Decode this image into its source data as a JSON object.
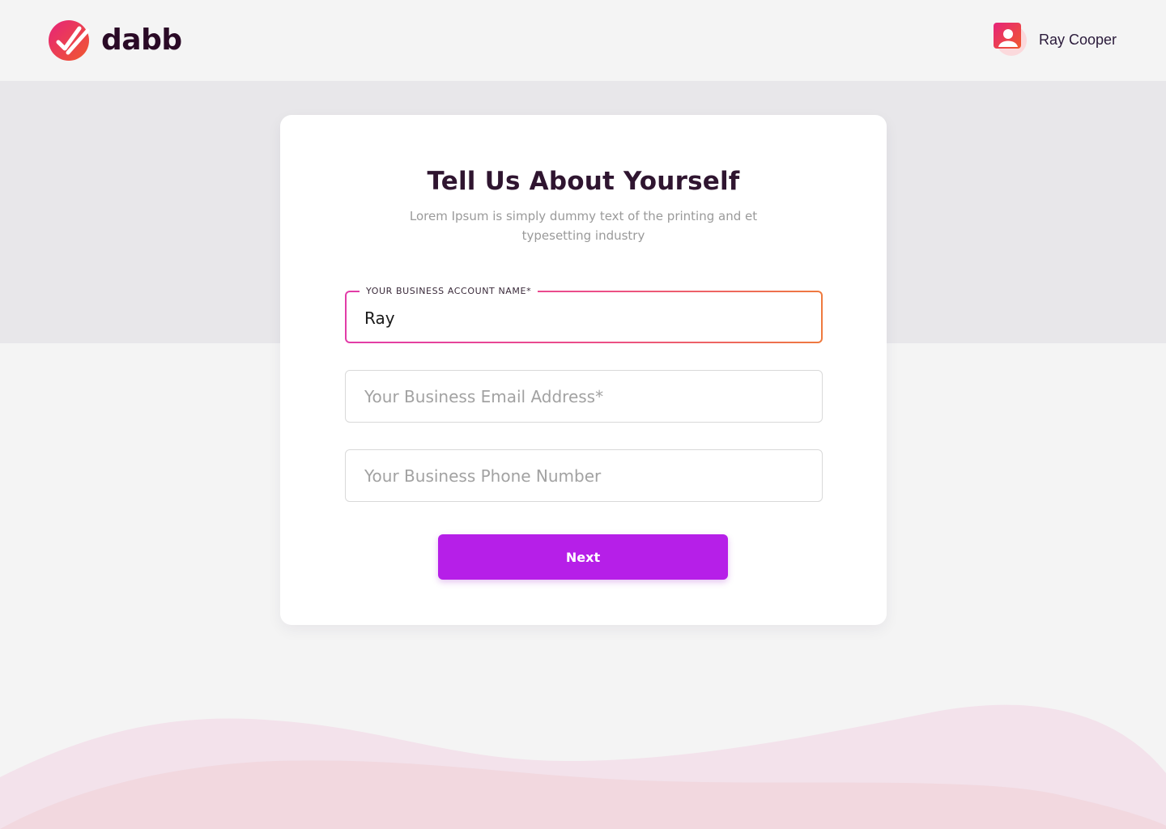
{
  "header": {
    "logo_text": "dabb",
    "user_name": "Ray Cooper"
  },
  "form": {
    "title": "Tell Us About Yourself",
    "subtitle": "Lorem Ipsum is simply dummy text of the printing and et typesetting industry",
    "account_name": {
      "label": "YOUR BUSINESS ACCOUNT NAME*",
      "value": "Ray"
    },
    "email": {
      "placeholder": "Your Business Email Address*",
      "value": ""
    },
    "phone": {
      "placeholder": "Your Business Phone Number",
      "value": ""
    },
    "next_label": "Next"
  },
  "colors": {
    "brand_primary": "#b61fe8",
    "logo_gradient_start": "#e6237a",
    "logo_gradient_end": "#f0592d",
    "active_border_start": "#e23ca8",
    "active_border_end": "#ef7a3e"
  },
  "icons": {
    "logo": "dabb-logo-icon",
    "avatar": "user-avatar-icon"
  }
}
